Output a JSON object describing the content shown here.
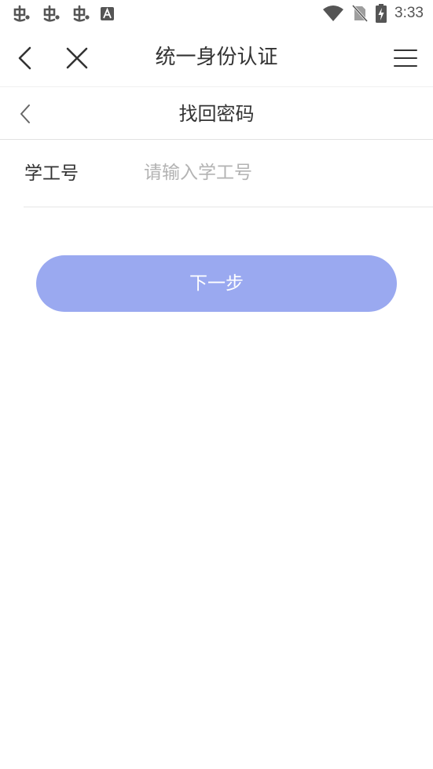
{
  "status_bar": {
    "time": "3:33",
    "left_icons": [
      "app-notification-icon",
      "app-notification-icon",
      "app-notification-icon",
      "font-app-icon"
    ],
    "right_icons": [
      "wifi-icon",
      "no-sim-icon",
      "battery-charging-icon"
    ]
  },
  "nav": {
    "title": "统一身份认证",
    "icons": [
      "back-icon",
      "close-icon",
      "menu-icon"
    ]
  },
  "sub_nav": {
    "title": "找回密码"
  },
  "form": {
    "id_label": "学工号",
    "id_value": "",
    "id_placeholder": "请输入学工号"
  },
  "actions": {
    "next_label": "下一步"
  },
  "colors": {
    "button": "#9aa9f0",
    "button_text": "#ffffff",
    "title_text": "#333333",
    "placeholder": "#b3b3b3",
    "divider": "#e2e2e2"
  }
}
